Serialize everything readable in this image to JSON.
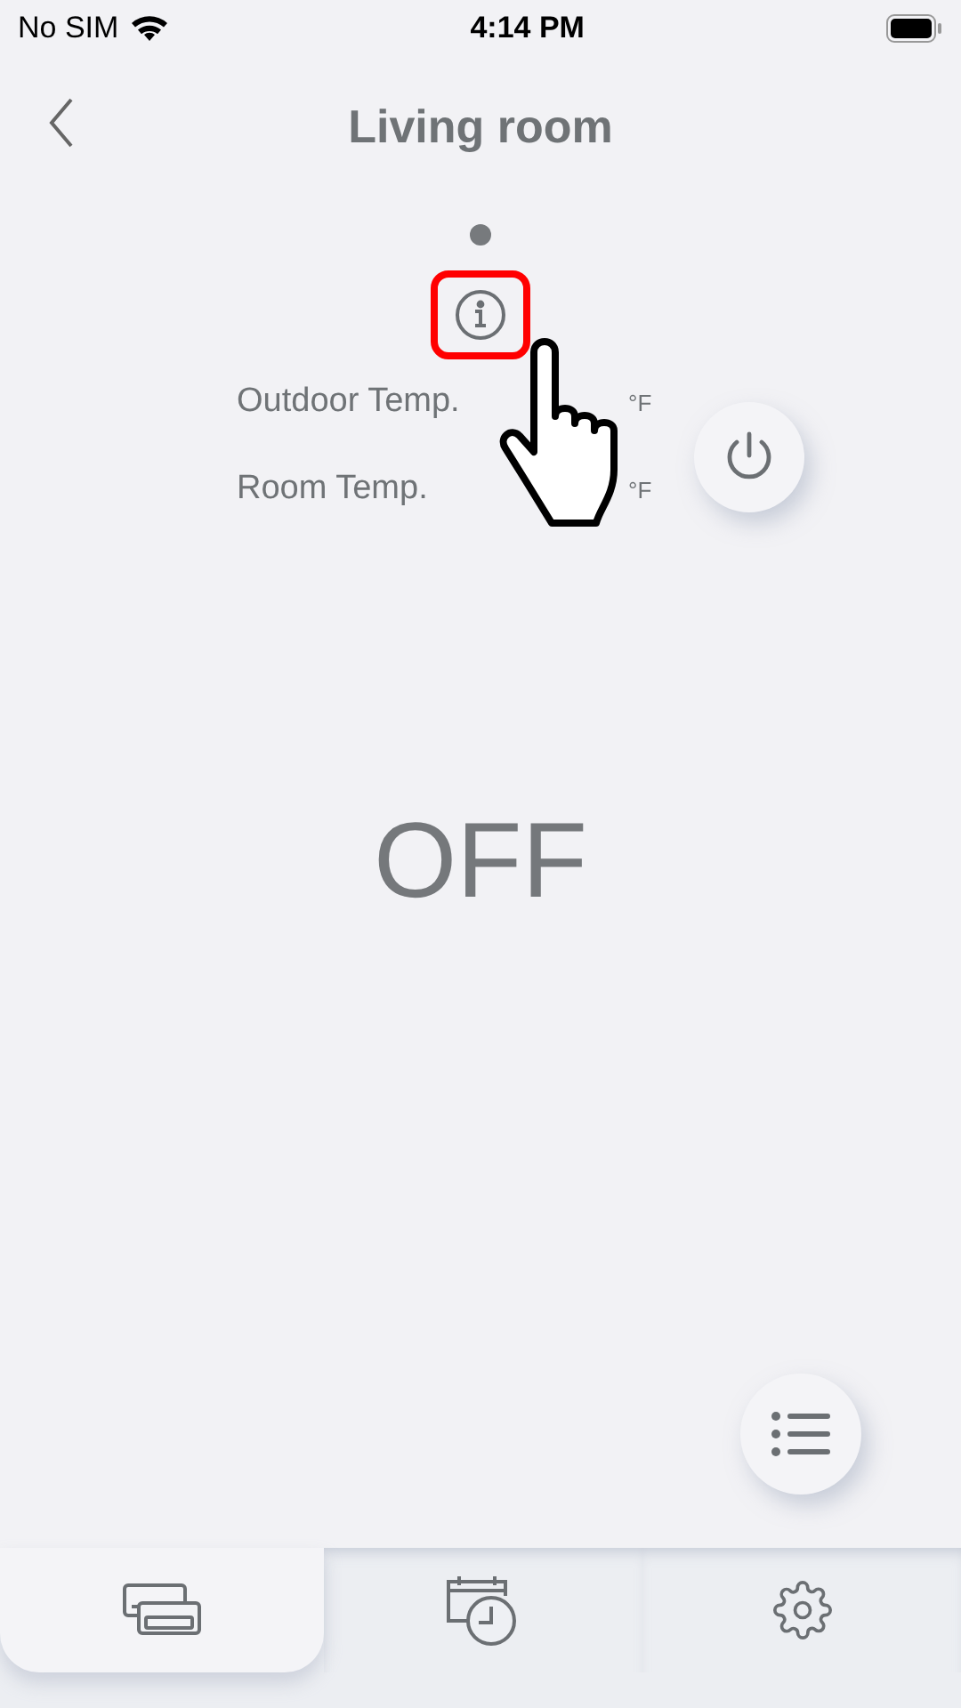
{
  "status_bar": {
    "carrier": "No SIM",
    "time": "4:14 PM"
  },
  "header": {
    "title": "Living room"
  },
  "pager": {
    "dots": [
      {
        "selected": true
      }
    ]
  },
  "info": {
    "highlighted": true
  },
  "readings": [
    {
      "label": "Outdoor Temp.",
      "unit": "°F"
    },
    {
      "label": "Room Temp.",
      "unit": "°F"
    }
  ],
  "power": {
    "on": false
  },
  "mode_text": "OFF",
  "tabs": [
    {
      "kind": "units",
      "selected": true
    },
    {
      "kind": "schedule",
      "selected": false
    },
    {
      "kind": "settings",
      "selected": false
    }
  ]
}
